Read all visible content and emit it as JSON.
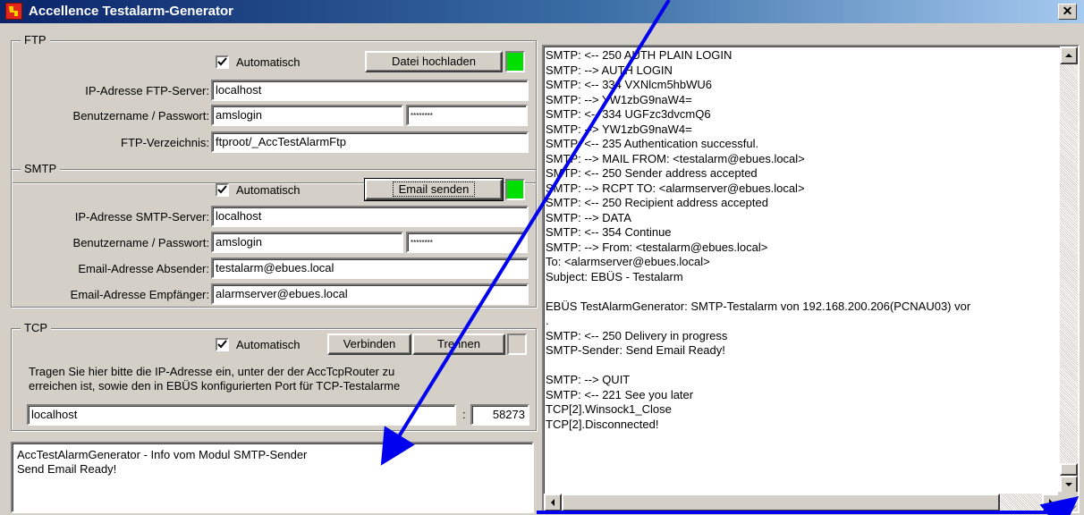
{
  "window": {
    "title": "Accellence Testalarm-Generator",
    "close_glyph": "✕"
  },
  "ftp": {
    "legend": "FTP",
    "auto_label": "Automatisch",
    "auto_checked": true,
    "upload_button": "Datei hochladen",
    "status_color": "#00e000",
    "ip_label": "IP-Adresse FTP-Server:",
    "ip_value": "localhost",
    "user_label": "Benutzername / Passwort:",
    "user_value": "amslogin",
    "password_value": "********",
    "dir_label": "FTP-Verzeichnis:",
    "dir_value": "ftproot/_AccTestAlarmFtp"
  },
  "smtp": {
    "legend": "SMTP",
    "auto_label": "Automatisch",
    "auto_checked": true,
    "send_button": "Email senden",
    "status_color": "#00e000",
    "ip_label": "IP-Adresse SMTP-Server:",
    "ip_value": "localhost",
    "user_label": "Benutzername / Passwort:",
    "user_value": "amslogin",
    "password_value": "********",
    "sender_label": "Email-Adresse Absender:",
    "sender_value": "testalarm@ebues.local",
    "recipient_label": "Email-Adresse Empfänger:",
    "recipient_value": "alarmserver@ebues.local"
  },
  "tcp": {
    "legend": "TCP",
    "auto_label": "Automatisch",
    "auto_checked": true,
    "connect_button": "Verbinden",
    "disconnect_button": "Trennen",
    "help_line1": "Tragen Sie hier bitte die IP-Adresse ein, unter der der AccTcpRouter zu",
    "help_line2": "erreichen ist, sowie den in EBÜS konfigurierten Port für TCP-Testalarme",
    "host_value": "localhost",
    "separator": ":",
    "port_value": "58273"
  },
  "info": {
    "line1": "AccTestAlarmGenerator - Info vom Modul SMTP-Sender",
    "line2": "Send Email Ready!"
  },
  "log": {
    "lines": [
      "SMTP: <-- 250 AUTH PLAIN LOGIN",
      "SMTP: --> AUTH LOGIN",
      "SMTP: <-- 334 VXNlcm5hbWU6",
      "SMTP: --> YW1zbG9naW4=",
      "SMTP: <-- 334 UGFzc3dvcmQ6",
      "SMTP: --> YW1zbG9naW4=",
      "SMTP: <-- 235 Authentication successful.",
      "SMTP: --> MAIL FROM: <testalarm@ebues.local>",
      "SMTP: <-- 250 Sender address accepted",
      "SMTP: --> RCPT TO: <alarmserver@ebues.local>",
      "SMTP: <-- 250 Recipient address accepted",
      "SMTP: --> DATA",
      "SMTP: <-- 354 Continue",
      "SMTP: --> From: <testalarm@ebues.local>",
      "To: <alarmserver@ebues.local>",
      "Subject: EBÜS - Testalarm",
      "",
      "EBÜS TestAlarmGenerator: SMTP-Testalarm von 192.168.200.206(PCNAU03) vor",
      ".",
      "SMTP: <-- 250 Delivery in progress",
      "SMTP-Sender: Send Email Ready!",
      "",
      "SMTP: --> QUIT",
      "SMTP: <-- 221 See you later",
      "TCP[2].Winsock1_Close",
      "TCP[2].Disconnected!"
    ]
  },
  "colors": {
    "arrow": "#0000ee",
    "status_ok": "#00e000"
  }
}
